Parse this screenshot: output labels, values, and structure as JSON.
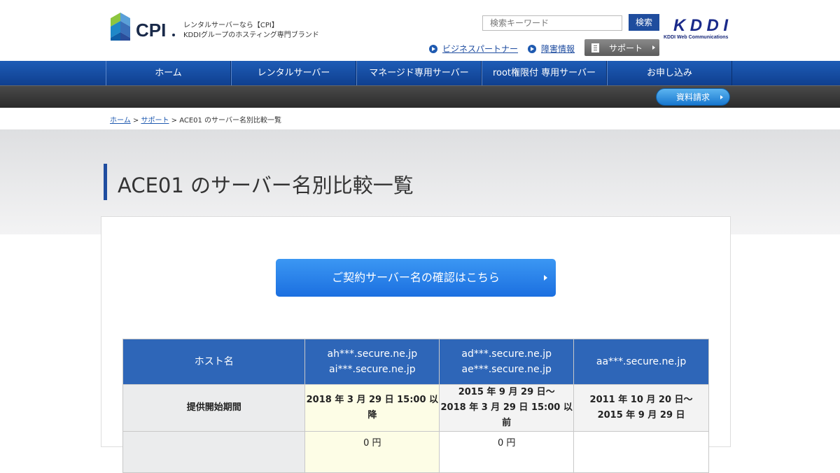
{
  "header": {
    "tagline_line1": "レンタルサーバーなら【CPI】",
    "tagline_line2": "KDDIグループのホスティング専門ブランド",
    "search_placeholder": "検索キーワード",
    "search_button": "検索",
    "kddi_sub": "KDDI Web Communications",
    "link_partner": "ビジネスパートナー",
    "link_trouble": "障害情報",
    "support_label": "サポート",
    "brand_color": "#1f4d9e"
  },
  "nav": {
    "items": [
      {
        "label": "ホーム"
      },
      {
        "label": "レンタルサーバー"
      },
      {
        "label": "マネージド専用サーバー"
      },
      {
        "label": "root権限付 専用サーバー"
      },
      {
        "label": "お申し込み"
      }
    ],
    "request_button": "資料請求"
  },
  "breadcrumb": {
    "home": "ホーム",
    "support": "サポート",
    "current": " > ACE01 のサーバー名別比較一覧",
    "sep": " > "
  },
  "page": {
    "title": "ACE01 のサーバー名別比較一覧",
    "confirm_button": "ご契約サーバー名の確認はこちら"
  },
  "table": {
    "header": {
      "label": "ホスト名",
      "col1_line1": "ah***.secure.ne.jp",
      "col1_line2": "ai***.secure.ne.jp",
      "col2_line1": "ad***.secure.ne.jp",
      "col2_line2": "ae***.secure.ne.jp",
      "col3_line1": "aa***.secure.ne.jp"
    },
    "row_period": {
      "label": "提供開始期間",
      "col1": "2018 年 3 月 29 日 15:00 以降",
      "col2_line1": "2015 年 9 月 29 日～",
      "col2_line2": "2018 年 3 月 29 日 15:00 以前",
      "col3_line1": "2011 年 10 月 20 日～",
      "col3_line2": "2015 年 9 月 29 日"
    },
    "row_price": {
      "col1": "0 円",
      "col2": "0 円"
    }
  }
}
